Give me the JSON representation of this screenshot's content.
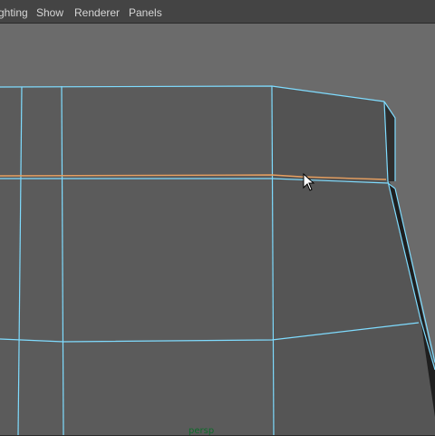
{
  "menubar": {
    "items": [
      {
        "label": "ghting"
      },
      {
        "label": "Show"
      },
      {
        "label": "Renderer"
      },
      {
        "label": "Panels"
      }
    ]
  },
  "viewport": {
    "camera_label": "persp",
    "background_color": "#6b6b6b",
    "wire_color": "#7fdcff",
    "selected_edge_color": "#e8a060",
    "camera_label_color": "#0d6b2a",
    "cursor_icon": "arrow-cursor-icon"
  }
}
